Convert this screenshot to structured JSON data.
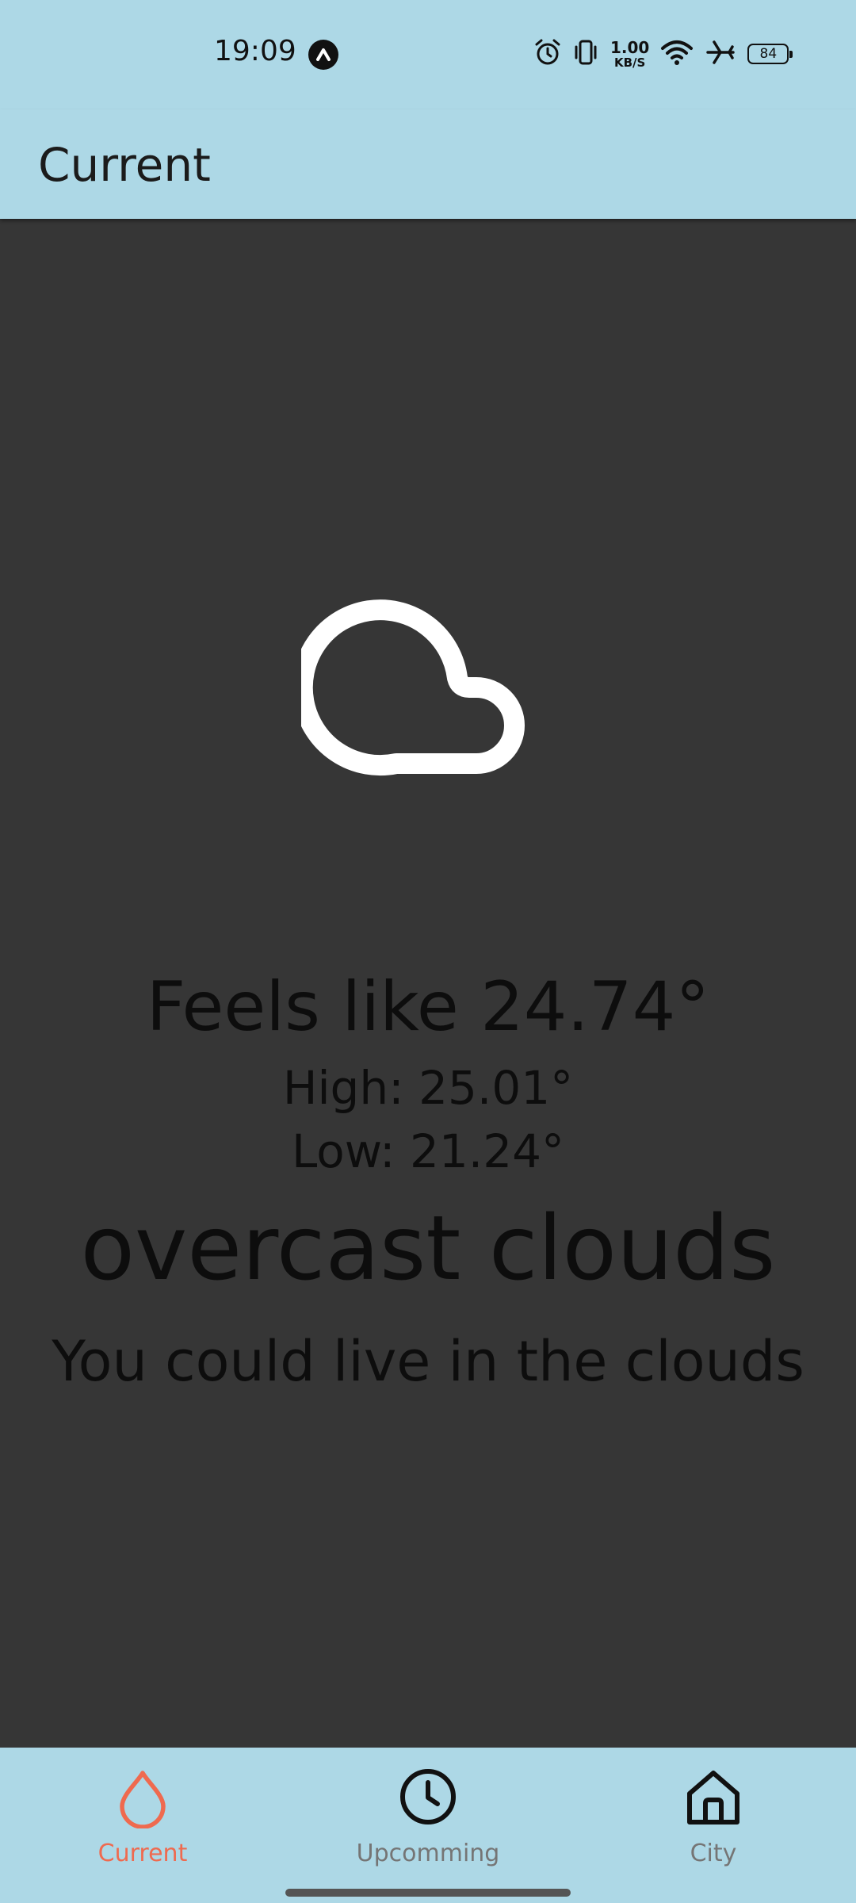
{
  "status_bar": {
    "time": "19:09",
    "network_speed_value": "1.00",
    "network_speed_unit": "KB/S",
    "battery_level": "84",
    "icons": [
      "nav-app-icon",
      "alarm-icon",
      "vibrate-icon",
      "wifi-icon",
      "airplane-mode-icon",
      "battery-icon"
    ]
  },
  "app_bar": {
    "title": "Current"
  },
  "weather": {
    "icon": "cloud-icon",
    "feels_like": "Feels like 24.74°",
    "high": "High: 25.01°",
    "low": "Low: 21.24°",
    "description": "overcast clouds",
    "quip": "You could live in the clouds"
  },
  "bottom_nav": {
    "items": [
      {
        "label": "Current",
        "icon": "water-drop-icon",
        "active": true
      },
      {
        "label": "Upcomming",
        "icon": "clock-icon",
        "active": false
      },
      {
        "label": "City",
        "icon": "home-icon",
        "active": false
      }
    ]
  },
  "colors": {
    "bar_background": "#add8e6",
    "content_background": "#363636",
    "active_accent": "#ef6a4f",
    "inactive_label": "#757575",
    "text_dark": "#0d0d0d"
  }
}
